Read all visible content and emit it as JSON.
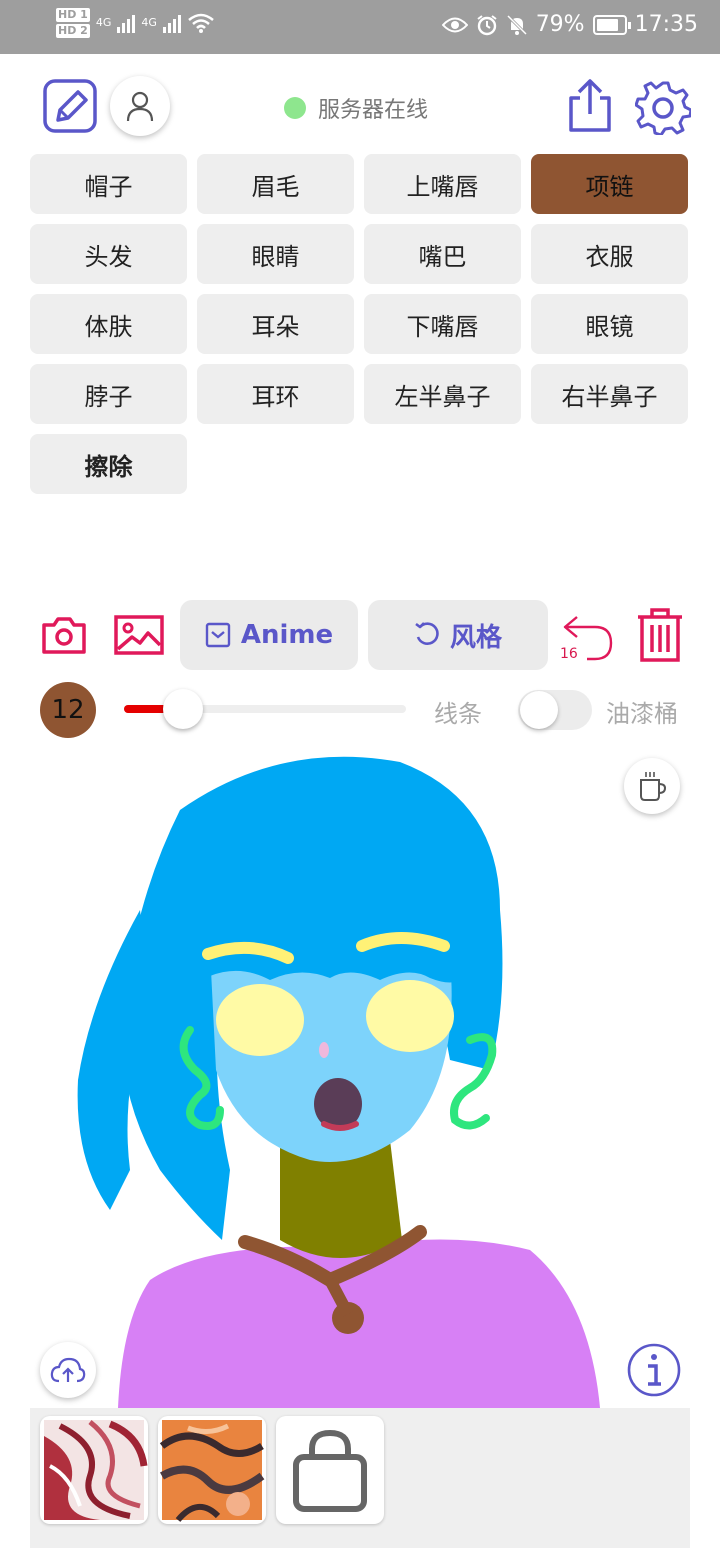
{
  "status_bar": {
    "hd1": "HD 1",
    "hd2": "HD 2",
    "net1": "4G",
    "net2": "4G",
    "battery": "79%",
    "battery_level": 0.79,
    "time": "17:35",
    "icons": [
      "eye-icon",
      "alarm-icon",
      "bell-off-icon",
      "battery-icon"
    ]
  },
  "topbar": {
    "server_status": "服务器在线",
    "server_status_color": "#8ee68e",
    "icons": [
      "edit-icon",
      "user-icon",
      "share-icon",
      "gear-icon"
    ]
  },
  "labels": [
    {
      "text": "帽子",
      "active": false
    },
    {
      "text": "眉毛",
      "active": false
    },
    {
      "text": "上嘴唇",
      "active": false
    },
    {
      "text": "项链",
      "active": true
    },
    {
      "text": "头发",
      "active": false
    },
    {
      "text": "眼睛",
      "active": false
    },
    {
      "text": "嘴巴",
      "active": false
    },
    {
      "text": "衣服",
      "active": false
    },
    {
      "text": "体肤",
      "active": false
    },
    {
      "text": "耳朵",
      "active": false
    },
    {
      "text": "下嘴唇",
      "active": false
    },
    {
      "text": "眼镜",
      "active": false
    },
    {
      "text": "脖子",
      "active": false
    },
    {
      "text": "耳环",
      "active": false
    },
    {
      "text": "左半鼻子",
      "active": false
    },
    {
      "text": "右半鼻子",
      "active": false
    },
    {
      "text": "擦除",
      "active": false
    }
  ],
  "toolbar": {
    "anime_label": "Anime",
    "style_label": "风格",
    "undo_count": "16",
    "accent_color": "#5a57c9",
    "danger_color": "#e0195a"
  },
  "brush": {
    "size": "12",
    "size_color": "#8f5532",
    "slider_fraction": 0.21,
    "line_label": "线条",
    "bucket_label": "油漆桶",
    "bucket_enabled": false
  },
  "canvas": {
    "colors": {
      "hair": "#00a8f3",
      "skin": "#7dd3fb",
      "eyes": "#fffaa5",
      "brows": "#fff176",
      "earrings": "#2ee67e",
      "neck": "#808000",
      "clothes": "#d780f5",
      "necklace": "#8f5532",
      "mouth": "#5a3d57",
      "lip": "#c23b58",
      "nose": "#f0b8dc"
    }
  },
  "style_tray": {
    "items": [
      "style-thumbnail-1",
      "style-thumbnail-2",
      "shopping-bag-icon"
    ]
  }
}
